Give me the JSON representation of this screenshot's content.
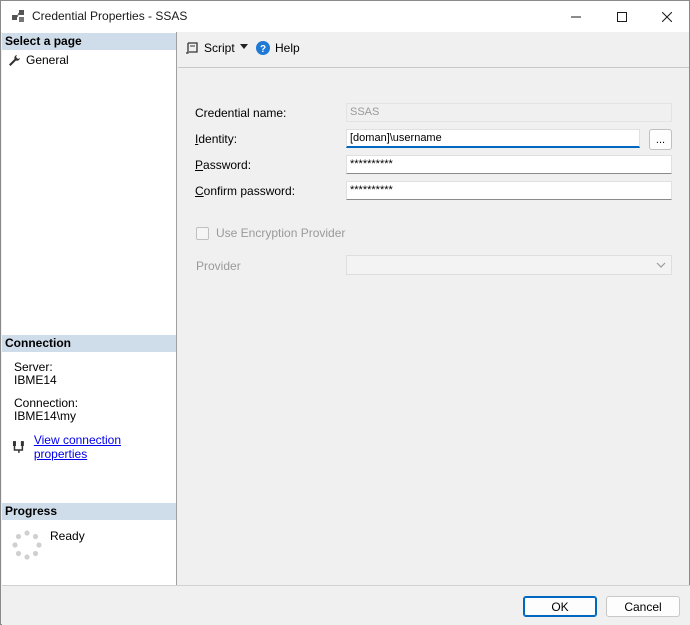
{
  "window": {
    "title": "Credential Properties - SSAS",
    "icons": {
      "app": "credential-icon",
      "minimize": "minimize-icon",
      "maximize": "maximize-icon",
      "close": "close-icon"
    }
  },
  "left_pane": {
    "select_page_header": "Select a page",
    "pages": [
      {
        "label": "General",
        "icon": "wrench-icon"
      }
    ],
    "connection_header": "Connection",
    "server_label": "Server:",
    "server_value": "IBME14",
    "connection_label": "Connection:",
    "connection_value": "IBME14\\my",
    "view_connection_link": "View connection properties",
    "progress_header": "Progress",
    "progress_status": "Ready"
  },
  "toolbar": {
    "script_label": "Script",
    "help_label": "Help"
  },
  "form": {
    "credential_name_label": "Credential name:",
    "credential_name_value": "SSAS",
    "identity_label_pre": "",
    "identity_label_u": "I",
    "identity_label_post": "dentity:",
    "identity_value": "[doman]\\username",
    "browse_label": "...",
    "password_label_u": "P",
    "password_label_post": "assword:",
    "password_value": "**********",
    "confirm_label_u": "C",
    "confirm_label_post": "onfirm password:",
    "confirm_value": "**********",
    "use_encryption_label": "Use Encryption Provider",
    "provider_label": "Provider",
    "provider_value": ""
  },
  "buttons": {
    "ok": "OK",
    "cancel": "Cancel"
  },
  "colors": {
    "section_header_bg": "#cfdce9",
    "accent": "#0067c0",
    "link": "#0000ee"
  }
}
